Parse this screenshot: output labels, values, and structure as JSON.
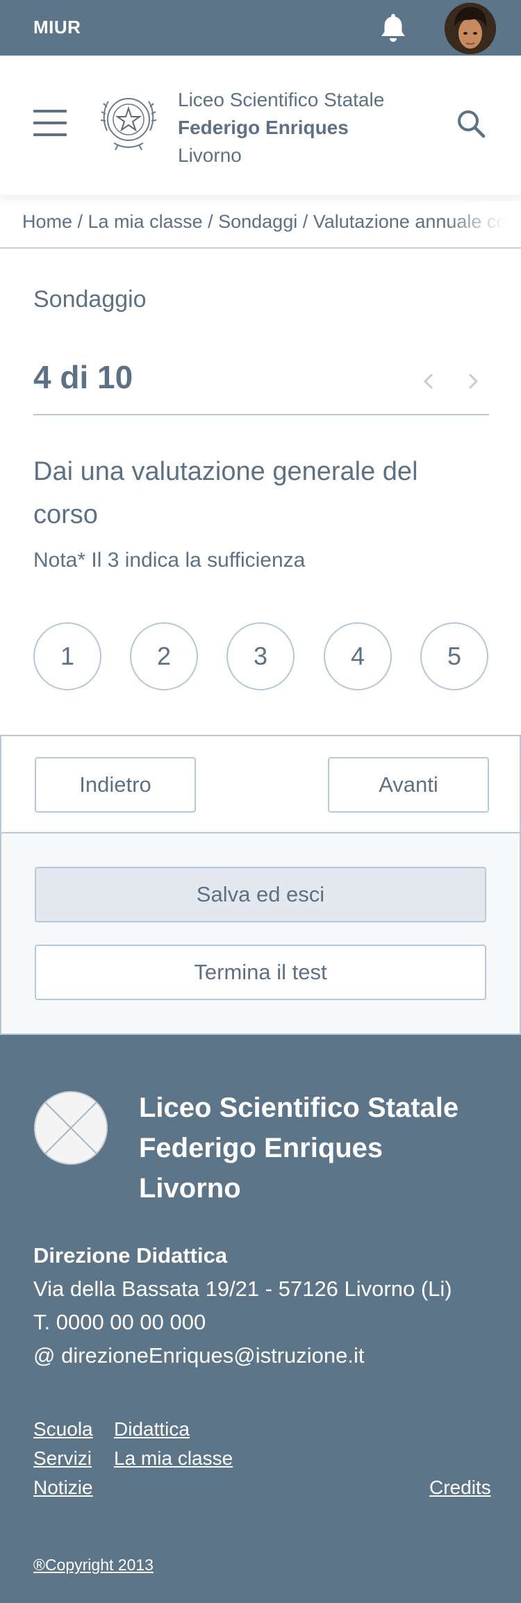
{
  "topbar": {
    "brand": "MIUR",
    "bell_icon": "bell-icon",
    "avatar_icon": "user-avatar"
  },
  "header": {
    "school_line1": "Liceo Scientifico Statale",
    "school_line2": "Federigo Enriques",
    "school_line3": "Livorno",
    "menu_icon": "hamburger-menu-icon",
    "emblem_icon": "italian-republic-emblem",
    "search_icon": "search-icon"
  },
  "breadcrumb": {
    "text": "Home / La mia classe / Sondaggi / Valutazione annuale corso"
  },
  "survey": {
    "label": "Sondaggio",
    "counter": "4 di 10",
    "question": "Dai una valutazione generale del corso",
    "note": "Nota* Il 3 indica la sufficienza",
    "ratings": [
      "1",
      "2",
      "3",
      "4",
      "5"
    ]
  },
  "actions": {
    "back": "Indietro",
    "next": "Avanti",
    "save_exit": "Salva ed esci",
    "finish": "Termina il test"
  },
  "footer": {
    "school_line1": "Liceo Scientifico Statale",
    "school_line2": "Federigo Enriques",
    "school_line3": "Livorno",
    "direction_title": "Direzione Didattica",
    "address": "Via della Bassata 19/21 - 57126 Livorno (Li)",
    "phone": "T. 0000 00 00 000",
    "email": "@ direzioneEnriques@istruzione.it",
    "links": {
      "scuola": "Scuola",
      "didattica": "Didattica",
      "servizi": "Servizi",
      "mia_classe": "La mia classe",
      "notizie": "Notizie",
      "credits": "Credits"
    },
    "copyright": "®Copyright 2013"
  },
  "colors": {
    "primary": "#5c7589",
    "text": "#5c7185",
    "border": "#b9c8d6",
    "save_bg": "#e3e8ee"
  }
}
